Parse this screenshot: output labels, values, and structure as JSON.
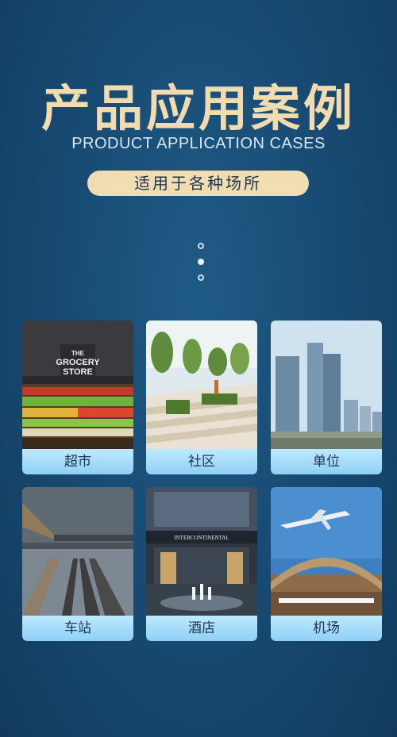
{
  "header": {
    "title": "产品应用案例",
    "subtitle": "PRODUCT APPLICATION CASES",
    "pill": "适用于各种场所"
  },
  "cards": [
    {
      "label": "超市",
      "sign_line1": "THE",
      "sign_line2": "GROCERY",
      "sign_line3": "STORE"
    },
    {
      "label": "社区"
    },
    {
      "label": "单位"
    },
    {
      "label": "车站"
    },
    {
      "label": "酒店",
      "sign": "INTERCONTINENTAL"
    },
    {
      "label": "机场"
    }
  ]
}
